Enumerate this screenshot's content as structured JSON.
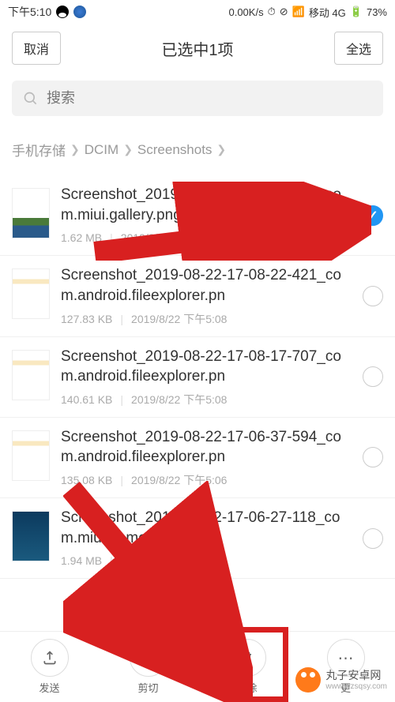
{
  "status": {
    "time": "下午5:10",
    "net_speed": "0.00K/s",
    "carrier": "移动 4G",
    "battery": "73%"
  },
  "header": {
    "cancel": "取消",
    "title": "已选中1项",
    "select_all": "全选"
  },
  "search": {
    "placeholder": "搜索"
  },
  "breadcrumb": {
    "items": [
      "手机存储",
      "DCIM",
      "Screenshots"
    ]
  },
  "files": [
    {
      "name": "Screenshot_2019-08-22-17-09-39-608_com.miui.gallery.png",
      "size": "1.62 MB",
      "date": "2019/8/22 下午5:09",
      "selected": true,
      "thumb": "landscape"
    },
    {
      "name": "Screenshot_2019-08-22-17-08-22-421_com.android.fileexplorer.pn",
      "size": "127.83 KB",
      "date": "2019/8/22 下午5:08",
      "selected": false,
      "thumb": "app"
    },
    {
      "name": "Screenshot_2019-08-22-17-08-17-707_com.android.fileexplorer.pn",
      "size": "140.61 KB",
      "date": "2019/8/22 下午5:08",
      "selected": false,
      "thumb": "app"
    },
    {
      "name": "Screenshot_2019-08-22-17-06-37-594_com.android.fileexplorer.pn",
      "size": "135.08 KB",
      "date": "2019/8/22 下午5:06",
      "selected": false,
      "thumb": "app"
    },
    {
      "name": "Screenshot_2019-08-22-17-06-27-118_com.miui.home.png",
      "size": "1.94 MB",
      "date": "2019/8/22 下午5:06",
      "selected": false,
      "thumb": "home"
    }
  ],
  "actions": {
    "send": "发送",
    "cut": "剪切",
    "delete": "删除",
    "more": "更"
  },
  "watermark": {
    "title": "丸子安卓网",
    "url": "www.wzsqsy.com"
  },
  "colors": {
    "accent": "#2196f3",
    "annotation": "#d82020",
    "brand": "#ff7a1a"
  }
}
